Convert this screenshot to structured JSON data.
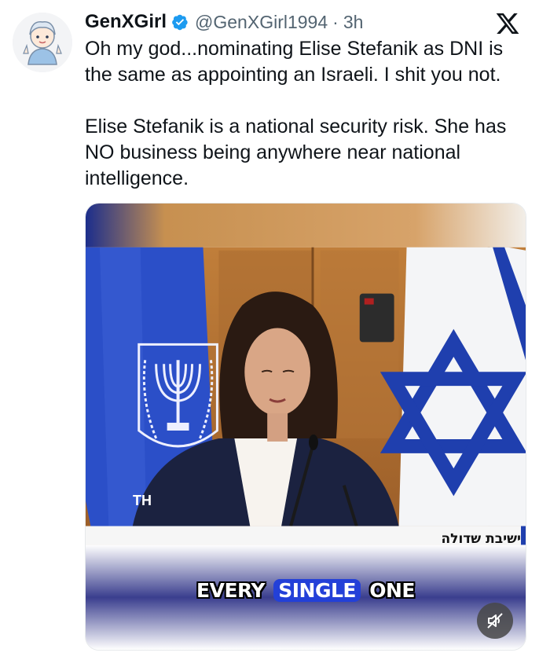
{
  "tweet": {
    "display_name": "GenXGirl",
    "handle": "@GenXGirl1994",
    "separator": "·",
    "time": "3h",
    "paragraphs": [
      "Oh my god...nominating Elise Stefanik as DNI is the same as appointing an Israeli. I shit you not.",
      "Elise Stefanik is a national security risk. She has NO business being anywhere near national intelligence."
    ]
  },
  "media": {
    "type": "video",
    "caption_words": [
      "EVERY",
      "SINGLE",
      "ONE"
    ],
    "highlighted_word": "SINGLE",
    "hebrew_banner": "ישיבת שדולה",
    "emblem_text": "TH",
    "muted": true
  },
  "icons": {
    "verified": "verified-badge-icon",
    "platform": "x-logo-icon",
    "mute": "speaker-muted-icon"
  },
  "colors": {
    "verified": "#1d9bf0",
    "text_primary": "#0f1419",
    "text_secondary": "#536471",
    "caption_highlight": "#2340d8",
    "flag_blue": "#2b4fc8"
  }
}
